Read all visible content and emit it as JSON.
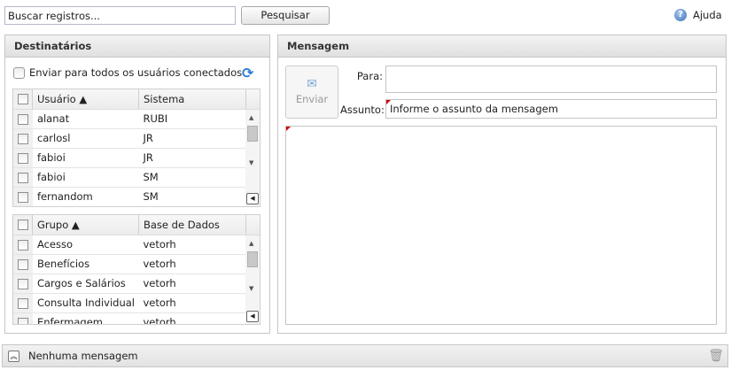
{
  "toolbar": {
    "search_value": "Buscar registros...",
    "search_label": "Pesquisar",
    "help_label": "Ajuda"
  },
  "recipients": {
    "title": "Destinatários",
    "send_all_label": "Enviar para todos os usuários conectados",
    "users": {
      "columns": [
        "Usuário ▲",
        "Sistema"
      ],
      "rows": [
        [
          "alanat",
          "RUBI"
        ],
        [
          "carlosl",
          "JR"
        ],
        [
          "fabioi",
          "JR"
        ],
        [
          "fabioi",
          "SM"
        ],
        [
          "fernandom",
          "SM"
        ]
      ]
    },
    "groups": {
      "columns": [
        "Grupo ▲",
        "Base de Dados"
      ],
      "rows": [
        [
          "Acesso",
          "vetorh"
        ],
        [
          "Benefícios",
          "vetorh"
        ],
        [
          "Cargos e Salários",
          "vetorh"
        ],
        [
          "Consulta Individual",
          "vetorh"
        ],
        [
          "Enfermagem",
          "vetorh"
        ]
      ]
    }
  },
  "message": {
    "title": "Mensagem",
    "send_label": "Enviar",
    "to_label": "Para:",
    "to_value": "",
    "subject_label": "Assunto:",
    "subject_placeholder": "Informe o assunto da mensagem",
    "body": ""
  },
  "status": {
    "text": "Nenhuma mensagem"
  }
}
